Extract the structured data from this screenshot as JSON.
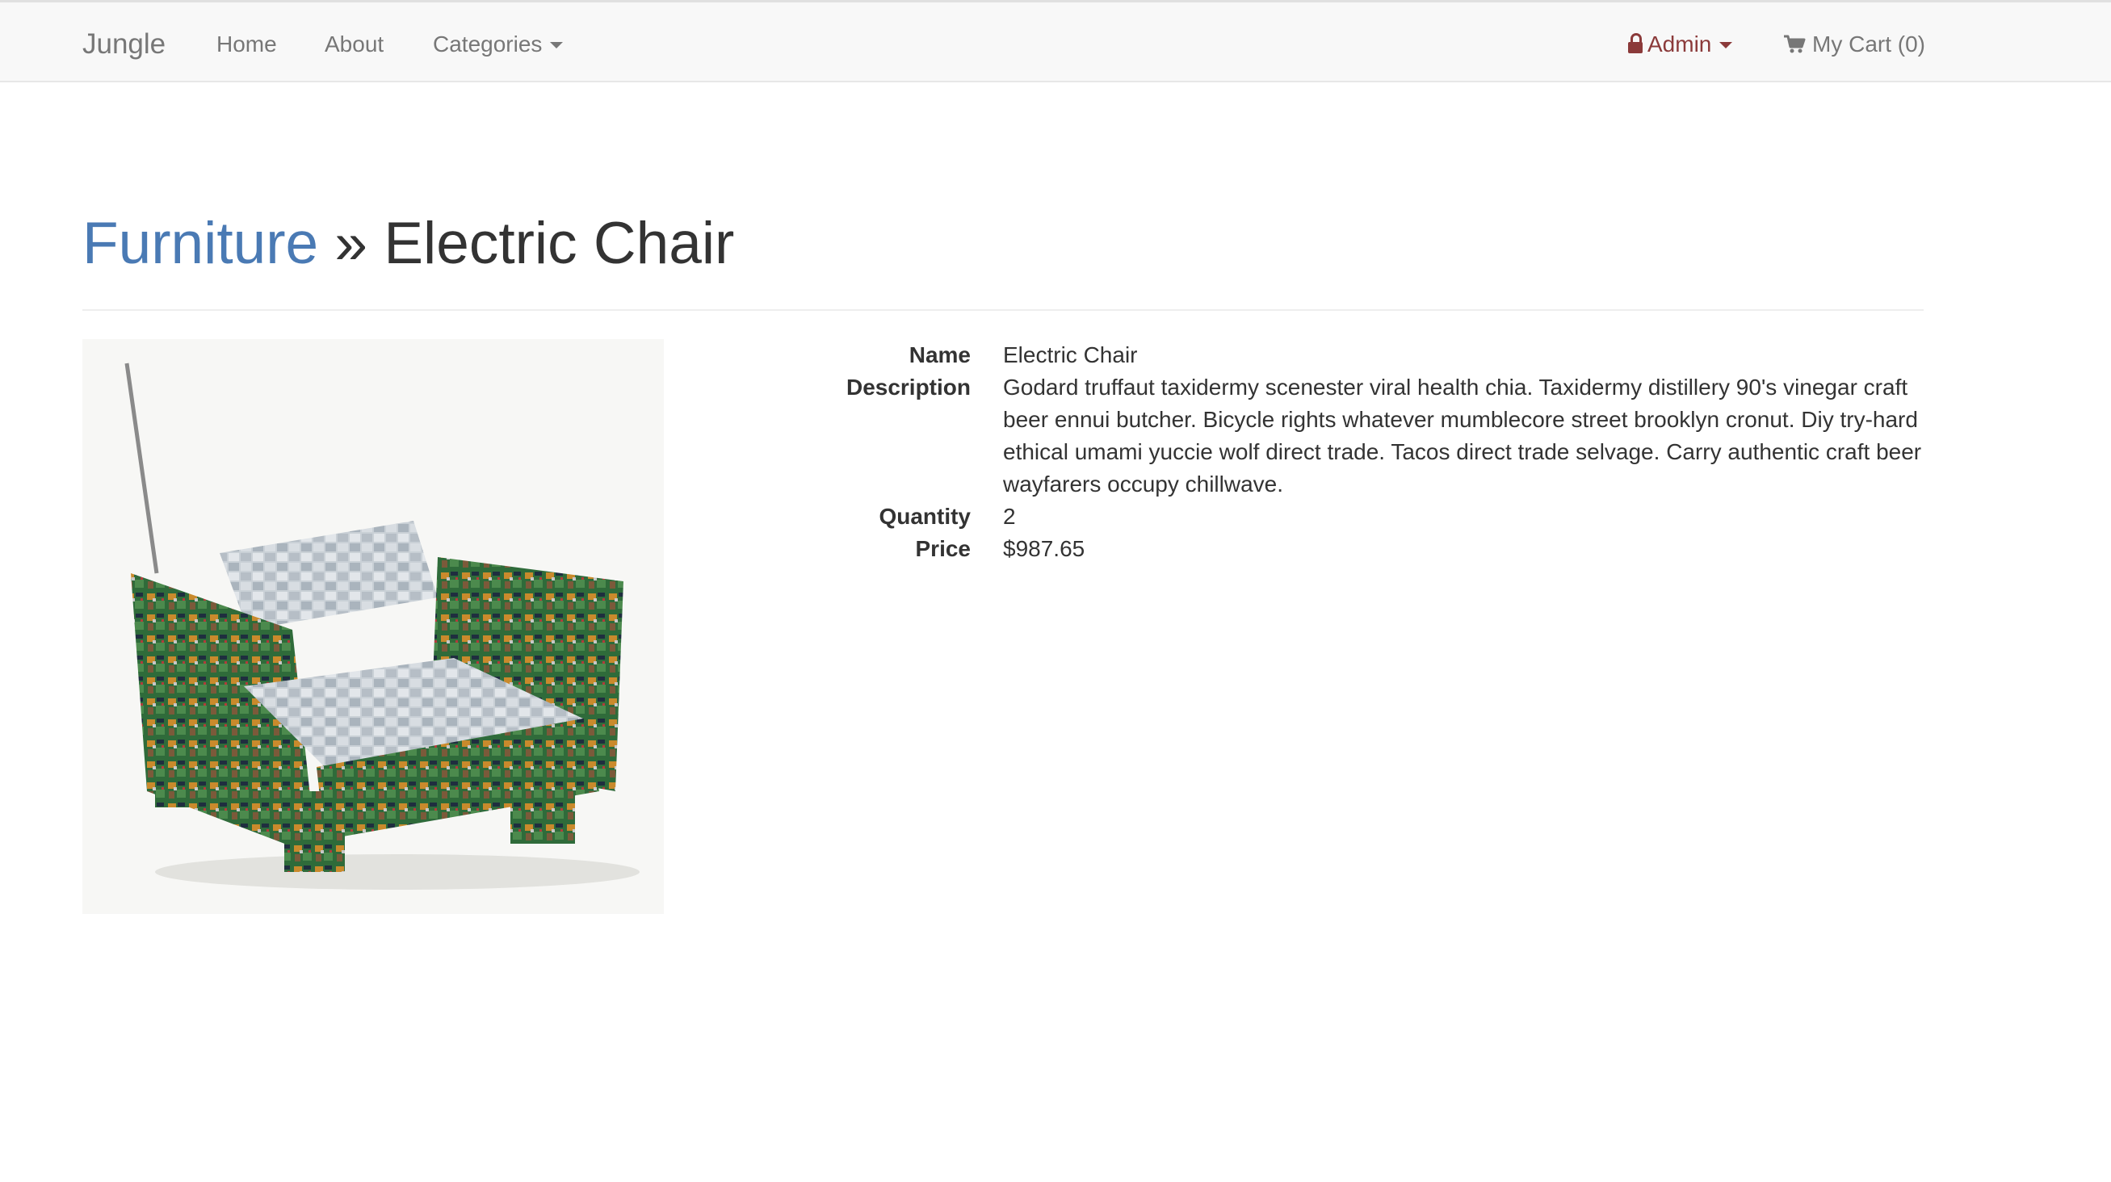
{
  "navbar": {
    "brand": "Jungle",
    "links": {
      "home": "Home",
      "about": "About",
      "categories": "Categories"
    },
    "admin": "Admin",
    "cart": "My Cart (0)"
  },
  "breadcrumb": {
    "category": "Furniture",
    "separator": "»",
    "product": "Electric Chair"
  },
  "product": {
    "labels": {
      "name": "Name",
      "description": "Description",
      "quantity": "Quantity",
      "price": "Price"
    },
    "name": "Electric Chair",
    "description": "Godard truffaut taxidermy scenester viral health chia. Taxidermy distillery 90's vinegar craft beer ennui butcher. Bicycle rights whatever mumblecore street brooklyn cronut. Diy try-hard ethical umami yuccie wolf direct trade. Tacos direct trade selvage. Carry authentic craft beer wayfarers occupy chillwave.",
    "quantity": "2",
    "price": "$987.65"
  },
  "colors": {
    "link": "#4a7ab4",
    "admin": "#8b3a3a",
    "navbar_bg": "#f8f8f8",
    "nav_text": "#777777"
  },
  "icons": {
    "admin": "lock-icon",
    "cart": "shopping-cart-icon",
    "dropdown": "caret-down-icon"
  }
}
